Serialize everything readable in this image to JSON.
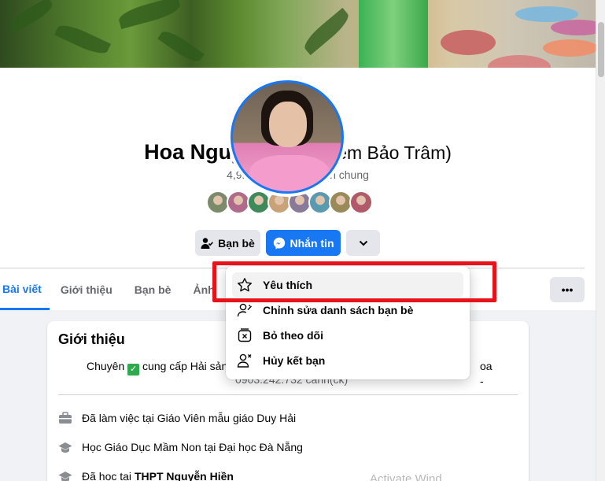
{
  "profile": {
    "name": "Hoa Nguyễn",
    "alternate_name": "(Gia Khiêm Bảo Trâm)",
    "friends_summary": "4,9K bạn bè • 548 bạn chung",
    "mutual_friend_colors": [
      "#7a8a6a",
      "#b06a8a",
      "#3f8a5a",
      "#c9a27a",
      "#8a7a9a",
      "#5a9ab0",
      "#9a8a5a",
      "#b05a6a"
    ]
  },
  "actions": {
    "friends_label": "Bạn bè",
    "message_label": "Nhắn tin",
    "more_label": "⌄"
  },
  "tabs": [
    {
      "label": "Bài viết"
    },
    {
      "label": "Giới thiệu"
    },
    {
      "label": "Bạn bè"
    },
    {
      "label": "Ảnh"
    }
  ],
  "tabs_more_label": "•••",
  "dropdown": {
    "items": [
      {
        "label": "Yêu thích",
        "icon": "star-icon"
      },
      {
        "label": "Chỉnh sửa danh sách bạn bè",
        "icon": "edit-friend-list-icon"
      },
      {
        "label": "Bỏ theo dõi",
        "icon": "unfollow-icon"
      },
      {
        "label": "Hủy kết bạn",
        "icon": "unfriend-icon"
      }
    ]
  },
  "intro": {
    "title": "Giới thiệu",
    "bio_prefix": "Chuyên",
    "bio_check": "✓",
    "bio_main": "cung cấp Hải sản",
    "bio_tail": "oa -",
    "bio_line2": "0903.242.732 cảnh(ck)",
    "items": [
      {
        "text": "Đã làm việc tại Giáo Viên mẫu giáo Duy Hải",
        "icon": "briefcase-icon"
      },
      {
        "text": "Học Giáo Dục Mầm Non tại Đại học Đà Nẵng",
        "icon": "graduation-cap-icon"
      },
      {
        "text_prefix": "Đã học tại ",
        "text_bold": "THPT Nguyễn Hiền",
        "icon": "graduation-cap-icon"
      }
    ]
  },
  "watermark": "Activate Wind"
}
